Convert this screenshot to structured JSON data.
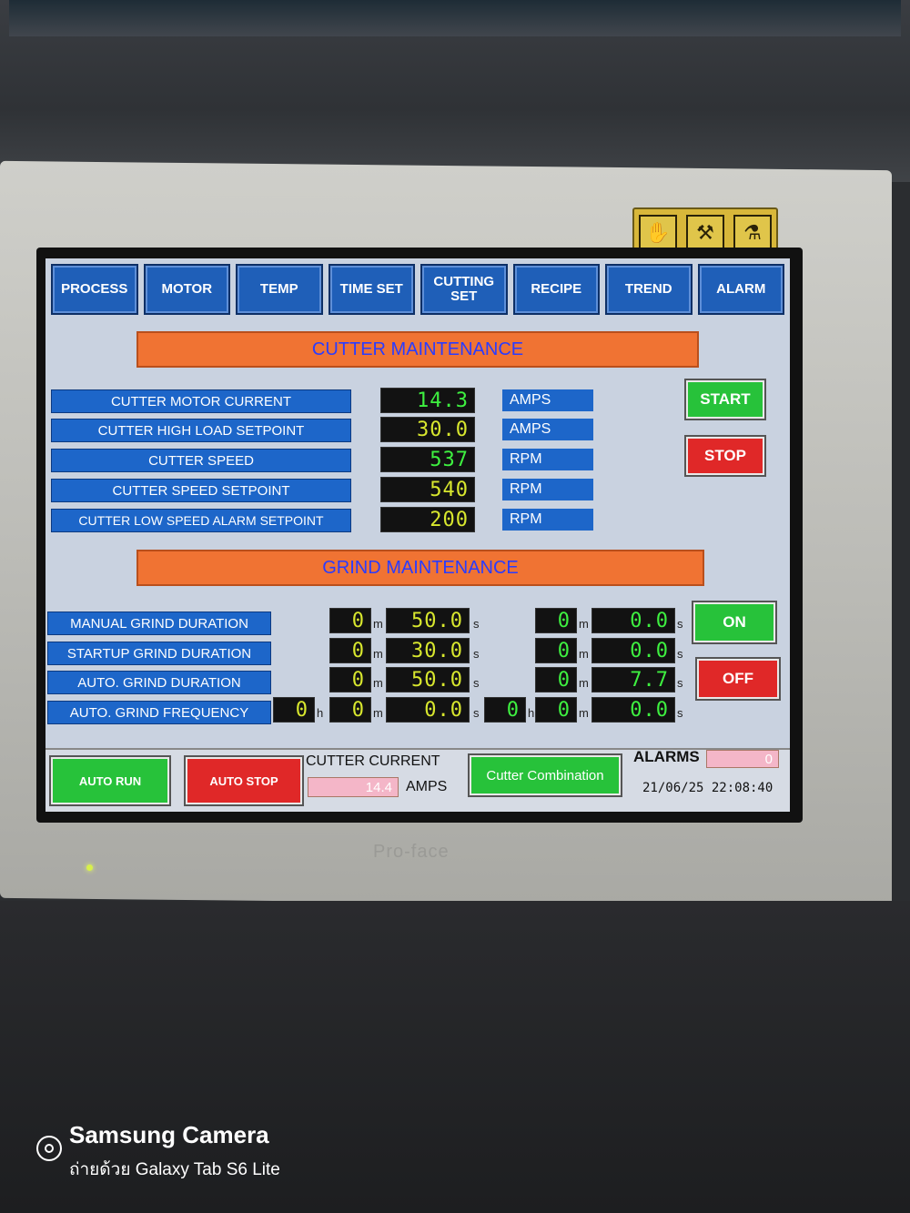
{
  "tabs": [
    "PROCESS",
    "MOTOR",
    "TEMP",
    "TIME SET",
    "CUTTING SET",
    "RECIPE",
    "TREND",
    "ALARM"
  ],
  "cutter": {
    "title": "CUTTER MAINTENANCE",
    "rows": [
      {
        "label": "CUTTER MOTOR CURRENT",
        "value": "14.3",
        "unit": "AMPS"
      },
      {
        "label": "CUTTER HIGH LOAD SETPOINT",
        "value": "30.0",
        "unit": "AMPS"
      },
      {
        "label": "CUTTER SPEED",
        "value": "537",
        "unit": "RPM"
      },
      {
        "label": "CUTTER SPEED SETPOINT",
        "value": "540",
        "unit": "RPM"
      },
      {
        "label": "CUTTER LOW SPEED ALARM SETPOINT",
        "value": "200",
        "unit": "RPM"
      }
    ],
    "start_label": "START",
    "stop_label": "STOP"
  },
  "grind": {
    "title": "GRIND MAINTENANCE",
    "rows": [
      {
        "label": "MANUAL GRIND DURATION",
        "set_m": "0",
        "set_s": "50.0",
        "act_m": "0",
        "act_s": "0.0"
      },
      {
        "label": "STARTUP GRIND DURATION",
        "set_m": "0",
        "set_s": "30.0",
        "act_m": "0",
        "act_s": "0.0"
      },
      {
        "label": "AUTO. GRIND DURATION",
        "set_m": "0",
        "set_s": "50.0",
        "act_m": "0",
        "act_s": "7.7"
      },
      {
        "label": "AUTO. GRIND FREQUENCY",
        "set_h": "0",
        "set_m": "0",
        "set_s": "0.0",
        "act_h": "0",
        "act_m": "0",
        "act_s": "0.0"
      }
    ],
    "m_suffix": "m",
    "s_suffix": "s",
    "h_suffix": "h",
    "on_label": "ON",
    "off_label": "OFF"
  },
  "bottom": {
    "auto_run_label": "AUTO RUN",
    "auto_stop_label": "AUTO STOP",
    "cutter_current_label": "CUTTER CURRENT",
    "cutter_current_value": "14.4",
    "cutter_current_unit": "AMPS",
    "combination_label": "Cutter Combination",
    "alarms_label": "ALARMS",
    "alarms_count": "0",
    "datetime": "21/06/25 22:08:40"
  },
  "device": {
    "brand": "Pro-face"
  },
  "watermark": {
    "title": "Samsung Camera",
    "subtitle": "ถ่ายด้วย Galaxy Tab S6 Lite"
  },
  "colors": {
    "tab_blue": "#1f5fb8",
    "section_orange": "#f07333",
    "button_green": "#27c23a",
    "button_red": "#e02828",
    "display_yellow": "#d8e72e",
    "display_green": "#3ef040"
  }
}
